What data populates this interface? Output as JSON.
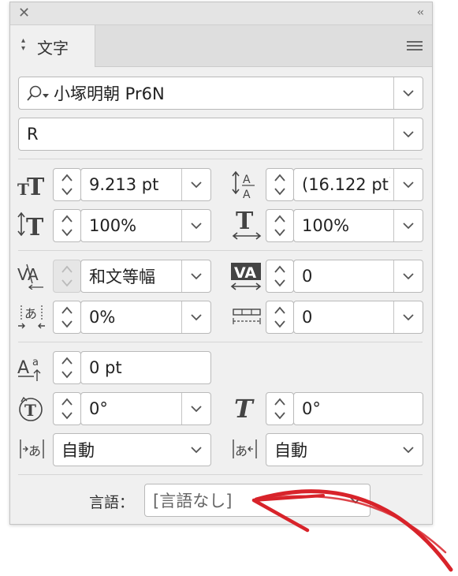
{
  "panel": {
    "close_glyph": "✕",
    "collapse_glyph": "‹‹",
    "tab_label": "文字",
    "tab_arrows_up": "▴",
    "tab_arrows_down": "▾"
  },
  "font": {
    "family": "小塚明朝 Pr6N",
    "style": "R"
  },
  "fields": {
    "font_size": "9.213 pt",
    "leading": "(16.122 pt)",
    "vertical_scale": "100%",
    "horizontal_scale": "100%",
    "kerning": "和文等幅",
    "tracking": "0",
    "tsume": "0%",
    "mojikumi": "0",
    "baseline_shift": "0 pt",
    "rotation": "0°",
    "skew": "0°",
    "aki_before": "自動",
    "aki_after": "自動"
  },
  "language": {
    "label": "言語：",
    "value": "[言語なし]"
  },
  "colors": {
    "annotation_arrow": "#d8232a"
  }
}
